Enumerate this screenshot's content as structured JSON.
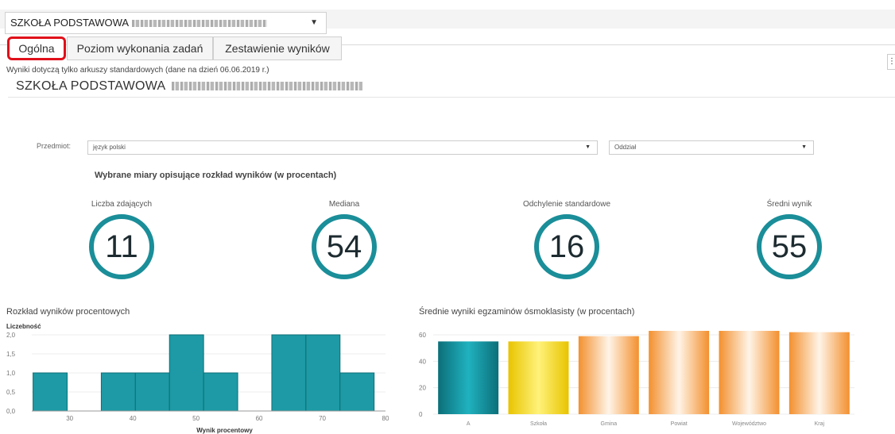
{
  "school_select": {
    "value": "SZKOŁA PODSTAWOWA"
  },
  "tabs": [
    {
      "label": "Ogólna",
      "active": true
    },
    {
      "label": "Poziom wykonania zadań"
    },
    {
      "label": "Zestawienie wyników"
    }
  ],
  "note": "Wyniki dotyczą tylko arkuszy standardowych (dane na dzień 06.06.2019 r.)",
  "school_title": "SZKOŁA PODSTAWOWA",
  "filters": {
    "subject_label": "Przedmiot:",
    "subject_value": "język polski",
    "class_value": "Oddział"
  },
  "stats_title": "Wybrane miary opisujące rozkład wyników (w procentach)",
  "kpis": [
    {
      "label": "Liczba zdających",
      "value": "11"
    },
    {
      "label": "Mediana",
      "value": "54"
    },
    {
      "label": "Odchylenie standardowe",
      "value": "16"
    },
    {
      "label": "Średni wynik",
      "value": "55"
    }
  ],
  "colors": {
    "accent": "#1a8e99",
    "active_tab_border": "#e0101a",
    "bar_teal": "#0e8c99",
    "bar_yellow": "#f0d21a",
    "bar_orange": "#f39a45"
  },
  "chart_data": [
    {
      "type": "bar",
      "title": "Rozkład wyników procentowych",
      "ylabel": "Liczebność",
      "xlabel": "Wynik procentowy",
      "x_ticks": [
        30,
        40,
        50,
        60,
        70,
        80
      ],
      "y_ticks": [
        "0,0",
        "0,5",
        "1,0",
        "1,5",
        "2,0"
      ],
      "ylim": [
        0,
        2
      ],
      "xlim": [
        24,
        80
      ],
      "bin_width": 5.4,
      "bins_start": [
        24.2,
        29.6,
        35.0,
        40.4,
        45.8,
        51.2,
        56.6,
        62.0,
        67.4,
        72.8
      ],
      "values": [
        1,
        0,
        1,
        1,
        2,
        1,
        0,
        2,
        2,
        1
      ]
    },
    {
      "type": "bar",
      "title": "Średnie wyniki egzaminów ósmoklasisty (w procentach)",
      "categories": [
        "A",
        "Szkoła",
        "Gmina",
        "Powiat",
        "Województwo",
        "Kraj"
      ],
      "values": [
        55,
        55,
        59,
        63,
        63,
        62
      ],
      "y_ticks": [
        0,
        20,
        40,
        60
      ],
      "ylim": [
        0,
        66
      ]
    }
  ]
}
